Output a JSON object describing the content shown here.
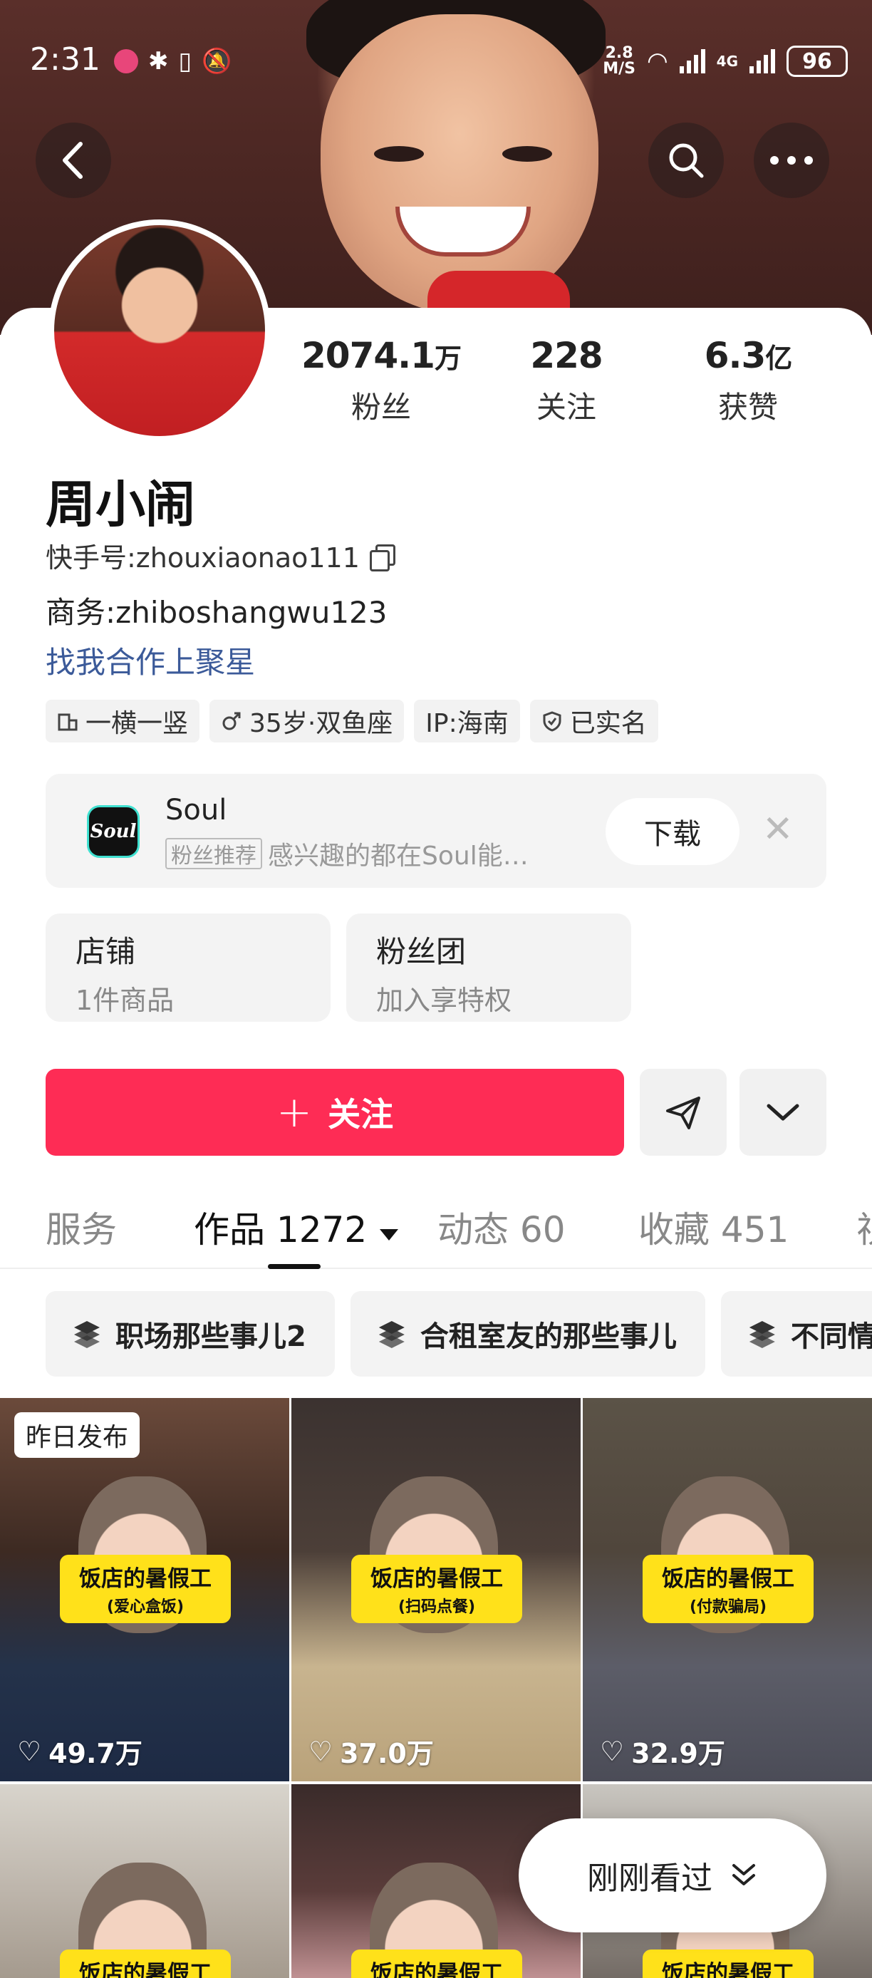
{
  "status_bar": {
    "time": "2:31",
    "net_speed_top": "2.8",
    "net_speed_bottom": "M/S",
    "network_type": "4G",
    "battery": "96"
  },
  "profile": {
    "name": "周小闹",
    "kuaishou_id_label": "快手号:zhouxiaonao111",
    "business": "商务:zhiboshangwu123",
    "cooperation_link": "找我合作上聚星"
  },
  "stats": {
    "fans_num": "2074.1",
    "fans_unit": "万",
    "fans_label": "粉丝",
    "following_num": "228",
    "following_label": "关注",
    "likes_num": "6.3",
    "likes_unit": "亿",
    "likes_label": "获赞"
  },
  "tags": [
    "一横一竖",
    "35岁·双鱼座",
    "IP:海南",
    "已实名"
  ],
  "ad": {
    "logo_text": "Soul",
    "title": "Soul",
    "badge": "粉丝推荐",
    "subtitle": "感兴趣的都在Soul能…",
    "download": "下载",
    "close": "✕"
  },
  "cards": {
    "shop_title": "店铺",
    "shop_sub": "1件商品",
    "fans_group_title": "粉丝团",
    "fans_group_sub": "加入享特权"
  },
  "actions": {
    "follow": "关注"
  },
  "tabs": {
    "service": "服务",
    "works": "作品 1272",
    "moments": "动态 60",
    "favorites": "收藏 451",
    "overflow": "视"
  },
  "collections": [
    "职场那些事儿2",
    "合租室友的那些事儿",
    "不同情"
  ],
  "videos": [
    {
      "badge": "昨日发布",
      "caption": "饭店的暑假工",
      "sub": "(爱心盒饭)",
      "likes": "49.7万"
    },
    {
      "caption": "饭店的暑假工",
      "sub": "(扫码点餐)",
      "likes": "37.0万"
    },
    {
      "caption": "饭店的暑假工",
      "sub": "(付款骗局)",
      "likes": "32.9万"
    },
    {
      "caption": "饭店的暑假工"
    },
    {
      "caption": "饭店的暑假工"
    },
    {
      "caption": "饭店的暑假工"
    }
  ],
  "recent_button": "刚刚看过",
  "colors": {
    "accent": "#fe2c55",
    "link": "#3b5a99",
    "caption_yellow": "#ffe11a"
  }
}
